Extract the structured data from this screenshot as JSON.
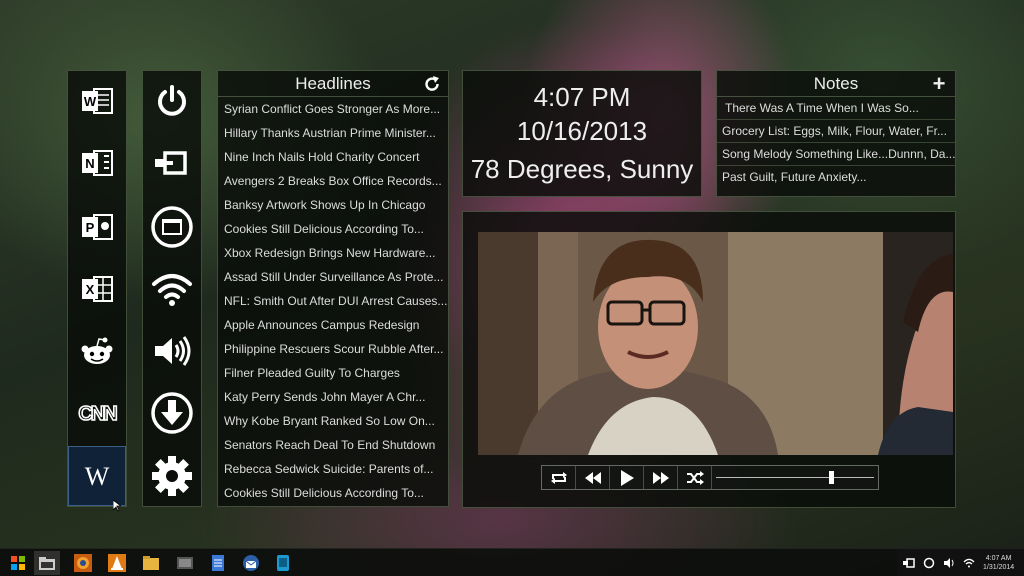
{
  "apps": [
    {
      "name": "word-icon",
      "label": "W"
    },
    {
      "name": "onenote-icon",
      "label": "N"
    },
    {
      "name": "powerpoint-icon",
      "label": "P"
    },
    {
      "name": "excel-icon",
      "label": "X"
    },
    {
      "name": "reddit-icon",
      "label": ""
    },
    {
      "name": "cnn-icon",
      "label": "CNN"
    },
    {
      "name": "wikipedia-icon",
      "label": "W"
    }
  ],
  "system": [
    "power-icon",
    "display-icon",
    "window-icon",
    "wifi-icon",
    "volume-icon",
    "download-icon",
    "settings-icon"
  ],
  "headlines": {
    "title": "Headlines",
    "refresh_icon": "refresh-icon",
    "items": [
      "Syrian Conflict Goes Stronger As More...",
      "Hillary Thanks Austrian Prime Minister...",
      "Nine Inch Nails Hold Charity Concert",
      "Avengers 2 Breaks Box Office Records...",
      "Banksy Artwork Shows Up In Chicago",
      "Cookies Still Delicious According To...",
      "Xbox Redesign Brings New Hardware...",
      "Assad Still Under Surveillance As Prote...",
      "NFL: Smith Out After DUI Arrest Causes...",
      "Apple Announces Campus Redesign",
      "Philippine Rescuers Scour Rubble After...",
      "Filner Pleaded Guilty To Charges",
      "Katy Perry Sends John Mayer A Chr...",
      "Why Kobe Bryant Ranked So Low On...",
      "Senators Reach Deal To End Shutdown",
      "Rebecca Sedwick Suicide: Parents of...",
      "Cookies Still Delicious According To..."
    ]
  },
  "clock": {
    "time": "4:07 PM",
    "date": "10/16/2013",
    "weather": "78 Degrees, Sunny"
  },
  "notes": {
    "title": "Notes",
    "add_label": "+",
    "items": [
      "There Was A Time When I Was So...",
      "Grocery List: Eggs, Milk, Flour, Water, Fr...",
      "Song Melody Something Like...Dunnn, Da...",
      "Past Guilt, Future Anxiety..."
    ]
  },
  "player": {
    "controls": [
      "repeat-icon",
      "rewind-icon",
      "play-icon",
      "fast-forward-icon",
      "shuffle-icon"
    ],
    "progress": 0.73
  },
  "taskbar": {
    "apps": [
      "start-icon",
      "file-explorer-icon",
      "firefox-icon",
      "vlc-icon",
      "folder-icon",
      "media-icon",
      "notepad-icon",
      "thunderbird-icon",
      "app-icon"
    ],
    "active_index": 1
  },
  "tray": {
    "time": "4:07 AM",
    "date": "1/31/2014"
  },
  "colors": {
    "accent": "#3a5f88",
    "panel_border": "#a0be8c",
    "wallpaper_petal": "#a54678"
  }
}
